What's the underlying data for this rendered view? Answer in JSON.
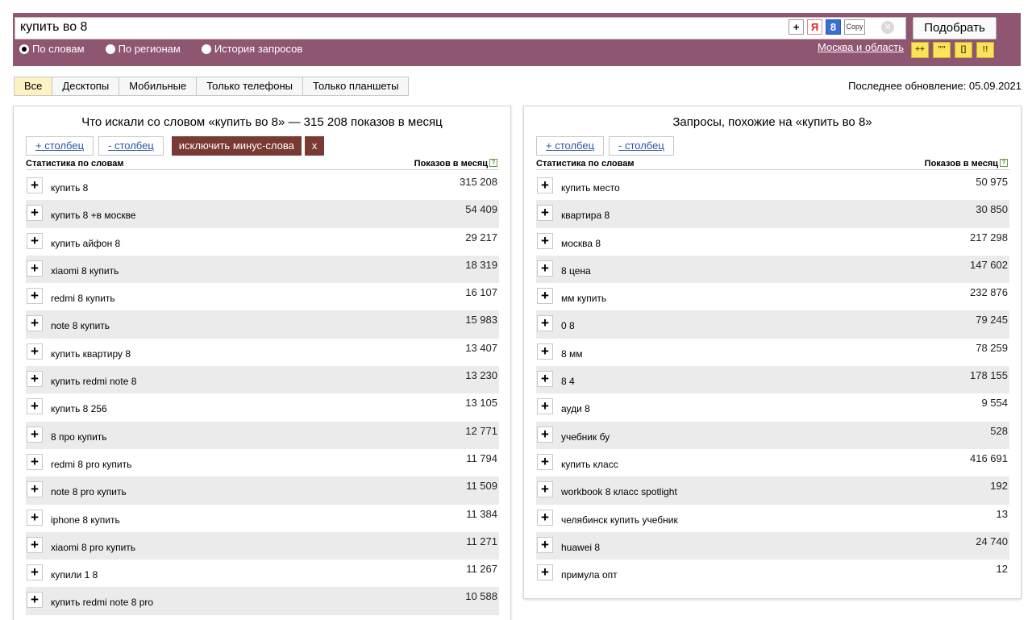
{
  "search": {
    "query": "купить во 8",
    "pick_label": "Подобрать",
    "radios": [
      {
        "label": "По словам",
        "selected": true
      },
      {
        "label": "По регионам",
        "selected": false
      },
      {
        "label": "История запросов",
        "selected": false
      }
    ],
    "region": "Москва и область",
    "icons": {
      "plus": "+",
      "yandex": "Я",
      "google": "8",
      "copy": "Copy",
      "clear": "✕"
    },
    "ops": [
      "++",
      "\"\"",
      "[]",
      "!!"
    ]
  },
  "tabs": [
    {
      "label": "Все",
      "active": true
    },
    {
      "label": "Десктопы",
      "active": false
    },
    {
      "label": "Мобильные",
      "active": false
    },
    {
      "label": "Только телефоны",
      "active": false
    },
    {
      "label": "Только планшеты",
      "active": false
    }
  ],
  "updated": "Последнее обновление: 05.09.2021",
  "left": {
    "title": "Что искали со словом «купить во 8» — 315 208 показов в месяц",
    "add_col": "+ столбец",
    "rem_col": "- столбец",
    "exclude": "исключить минус-слова",
    "exclude_x": "x",
    "head_left": "Статистика по словам",
    "head_right": "Показов в месяц",
    "rows": [
      {
        "kw": "купить 8",
        "cnt": "315 208"
      },
      {
        "kw": "купить 8 +в москве",
        "cnt": "54 409"
      },
      {
        "kw": "купить айфон 8",
        "cnt": "29 217"
      },
      {
        "kw": "xiaomi 8 купить",
        "cnt": "18 319"
      },
      {
        "kw": "redmi 8 купить",
        "cnt": "16 107"
      },
      {
        "kw": "note 8 купить",
        "cnt": "15 983"
      },
      {
        "kw": "купить квартиру 8",
        "cnt": "13 407"
      },
      {
        "kw": "купить redmi note 8",
        "cnt": "13 230"
      },
      {
        "kw": "купить 8 256",
        "cnt": "13 105"
      },
      {
        "kw": "8 про купить",
        "cnt": "12 771"
      },
      {
        "kw": "redmi 8 pro купить",
        "cnt": "11 794"
      },
      {
        "kw": "note 8 pro купить",
        "cnt": "11 509"
      },
      {
        "kw": "iphone 8 купить",
        "cnt": "11 384"
      },
      {
        "kw": "xiaomi 8 pro купить",
        "cnt": "11 271"
      },
      {
        "kw": "купили 1 8",
        "cnt": "11 267"
      },
      {
        "kw": "купить redmi note 8 pro",
        "cnt": "10 588"
      }
    ]
  },
  "right": {
    "title": "Запросы, похожие на «купить во 8»",
    "add_col": "+ столбец",
    "rem_col": "- столбец",
    "head_left": "Статистика по словам",
    "head_right": "Показов в месяц",
    "rows": [
      {
        "kw": "купить место",
        "cnt": "50 975"
      },
      {
        "kw": "квартира 8",
        "cnt": "30 850"
      },
      {
        "kw": "москва 8",
        "cnt": "217 298"
      },
      {
        "kw": "8 цена",
        "cnt": "147 602"
      },
      {
        "kw": "мм купить",
        "cnt": "232 876"
      },
      {
        "kw": "0 8",
        "cnt": "79 245"
      },
      {
        "kw": "8 мм",
        "cnt": "78 259"
      },
      {
        "kw": "8 4",
        "cnt": "178 155"
      },
      {
        "kw": "ауди 8",
        "cnt": "9 554"
      },
      {
        "kw": "учебник бу",
        "cnt": "528"
      },
      {
        "kw": "купить класс",
        "cnt": "416 691"
      },
      {
        "kw": "workbook 8 класс spotlight",
        "cnt": "192"
      },
      {
        "kw": "челябинск купить учебник",
        "cnt": "13"
      },
      {
        "kw": "huawei 8",
        "cnt": "24 740"
      },
      {
        "kw": "примула опт",
        "cnt": "12"
      }
    ]
  }
}
